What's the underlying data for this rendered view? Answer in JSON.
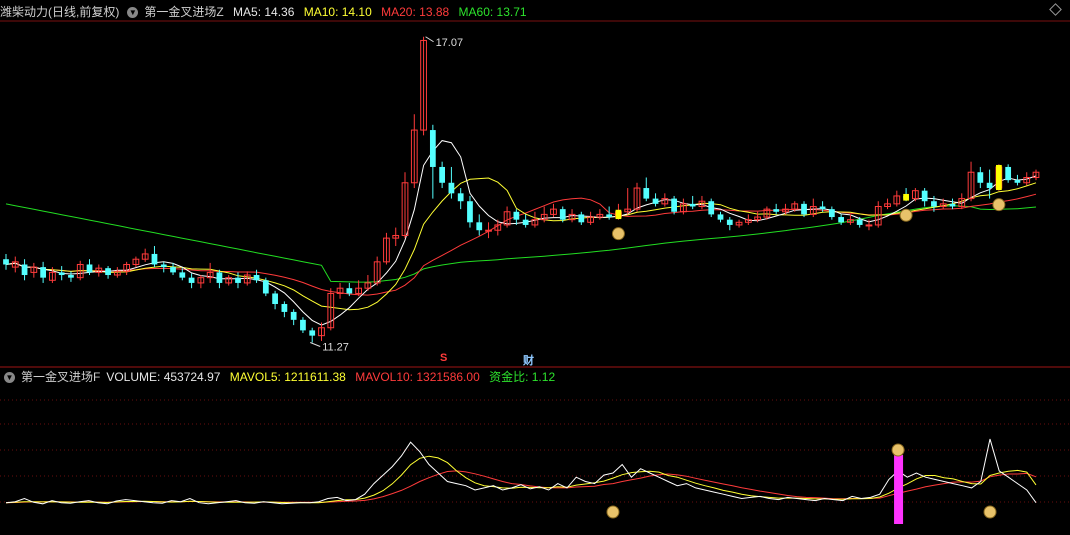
{
  "main_header": {
    "stock": "潍柴动力(日线,前复权)",
    "indicator": "第一金叉进场Z",
    "ma5": "MA5: 14.36",
    "ma10": "MA10: 14.10",
    "ma20": "MA20: 13.88",
    "ma60": "MA60: 13.71"
  },
  "vol_header": {
    "indicator": "第一金叉进场F",
    "volume": "VOLUME: 453724.97",
    "mavol5": "MAVOL5: 1211611.38",
    "mavol10": "MAVOL10: 1321586.00",
    "fund_ratio": "资金比: 1.12"
  },
  "markers": {
    "s": "S",
    "cai": "财"
  },
  "colors": {
    "up": "#ff3b3b",
    "down": "#54ffff",
    "ma5": "#ffffff",
    "ma10": "#ffff33",
    "ma20": "#ff3b3b",
    "ma60": "#22dd22",
    "signal": "#ffff00",
    "vol_spike": "#ff33ff"
  },
  "chart_data": [
    {
      "type": "candlestick",
      "title": "潍柴动力(日线,前复权)",
      "annotations": {
        "high": "17.07",
        "low": "11.27"
      },
      "ylim": [
        10.9,
        17.35
      ],
      "candles": [
        [
          12.85,
          12.75,
          12.95,
          12.65
        ],
        [
          12.7,
          12.8,
          12.9,
          12.6
        ],
        [
          12.75,
          12.55,
          12.85,
          12.45
        ],
        [
          12.6,
          12.7,
          12.78,
          12.5
        ],
        [
          12.7,
          12.5,
          12.8,
          12.4
        ],
        [
          12.45,
          12.6,
          12.7,
          12.4
        ],
        [
          12.6,
          12.55,
          12.72,
          12.45
        ],
        [
          12.55,
          12.5,
          12.62,
          12.42
        ],
        [
          12.5,
          12.75,
          12.82,
          12.45
        ],
        [
          12.75,
          12.6,
          12.85,
          12.55
        ],
        [
          12.6,
          12.68,
          12.75,
          12.52
        ],
        [
          12.68,
          12.55,
          12.72,
          12.48
        ],
        [
          12.55,
          12.62,
          12.7,
          12.5
        ],
        [
          12.62,
          12.75,
          12.8,
          12.55
        ],
        [
          12.75,
          12.85,
          12.9,
          12.7
        ],
        [
          12.85,
          12.95,
          13.05,
          12.8
        ],
        [
          12.95,
          12.75,
          13.1,
          12.7
        ],
        [
          12.75,
          12.7,
          12.8,
          12.6
        ],
        [
          12.7,
          12.6,
          12.78,
          12.55
        ],
        [
          12.6,
          12.5,
          12.68,
          12.45
        ],
        [
          12.5,
          12.4,
          12.58,
          12.3
        ],
        [
          12.4,
          12.5,
          12.55,
          12.3
        ],
        [
          12.5,
          12.6,
          12.78,
          12.4
        ],
        [
          12.6,
          12.4,
          12.65,
          12.3
        ],
        [
          12.4,
          12.5,
          12.55,
          12.35
        ],
        [
          12.5,
          12.4,
          12.6,
          12.3
        ],
        [
          12.4,
          12.55,
          12.62,
          12.35
        ],
        [
          12.55,
          12.45,
          12.65,
          12.4
        ],
        [
          12.45,
          12.2,
          12.5,
          12.15
        ],
        [
          12.2,
          12.0,
          12.25,
          11.9
        ],
        [
          12.0,
          11.85,
          12.05,
          11.75
        ],
        [
          11.85,
          11.7,
          11.9,
          11.6
        ],
        [
          11.7,
          11.5,
          11.75,
          11.45
        ],
        [
          11.5,
          11.4,
          11.55,
          11.27
        ],
        [
          11.4,
          11.55,
          11.65,
          11.3
        ],
        [
          11.55,
          12.2,
          12.3,
          11.5
        ],
        [
          12.2,
          12.3,
          12.4,
          12.1
        ],
        [
          12.3,
          12.2,
          12.4,
          12.15
        ],
        [
          12.2,
          12.3,
          12.45,
          12.15
        ],
        [
          12.3,
          12.4,
          12.55,
          12.25
        ],
        [
          12.4,
          12.8,
          12.9,
          12.35
        ],
        [
          12.8,
          13.25,
          13.35,
          12.75
        ],
        [
          13.25,
          13.3,
          13.45,
          13.1
        ],
        [
          13.3,
          14.3,
          14.5,
          13.25
        ],
        [
          14.3,
          15.3,
          15.6,
          14.2
        ],
        [
          15.3,
          17.0,
          17.07,
          15.2
        ],
        [
          15.3,
          14.6,
          15.4,
          14.0
        ],
        [
          14.6,
          14.3,
          14.7,
          14.2
        ],
        [
          14.3,
          14.1,
          14.6,
          14.0
        ],
        [
          14.1,
          13.95,
          14.2,
          13.8
        ],
        [
          13.95,
          13.55,
          14.05,
          13.45
        ],
        [
          13.55,
          13.4,
          13.7,
          13.3
        ],
        [
          13.4,
          13.4,
          13.55,
          13.25
        ],
        [
          13.4,
          13.5,
          13.6,
          13.3
        ],
        [
          13.5,
          13.75,
          13.85,
          13.45
        ],
        [
          13.75,
          13.6,
          13.8,
          13.5
        ],
        [
          13.6,
          13.5,
          13.7,
          13.45
        ],
        [
          13.5,
          13.6,
          13.75,
          13.45
        ],
        [
          13.6,
          13.7,
          13.85,
          13.55
        ],
        [
          13.7,
          13.8,
          13.9,
          13.65
        ],
        [
          13.8,
          13.6,
          13.85,
          13.55
        ],
        [
          13.6,
          13.7,
          13.8,
          13.55
        ],
        [
          13.7,
          13.55,
          13.75,
          13.5
        ],
        [
          13.55,
          13.65,
          13.75,
          13.5
        ],
        [
          13.65,
          13.7,
          13.8,
          13.6
        ],
        [
          13.7,
          13.65,
          13.85,
          13.6
        ],
        [
          13.65,
          13.75,
          13.9,
          13.6
        ],
        [
          13.75,
          13.8,
          14.2,
          13.7
        ],
        [
          13.8,
          14.2,
          14.3,
          13.75
        ],
        [
          14.2,
          14.0,
          14.4,
          13.95
        ],
        [
          14.0,
          13.9,
          14.1,
          13.85
        ],
        [
          13.9,
          14.0,
          14.1,
          13.85
        ],
        [
          14.0,
          13.75,
          14.05,
          13.7
        ],
        [
          13.75,
          13.9,
          14.0,
          13.7
        ],
        [
          13.9,
          13.85,
          14.05,
          13.8
        ],
        [
          13.85,
          13.95,
          14.05,
          13.8
        ],
        [
          13.95,
          13.7,
          14.0,
          13.65
        ],
        [
          13.7,
          13.6,
          13.75,
          13.55
        ],
        [
          13.6,
          13.5,
          13.65,
          13.4
        ],
        [
          13.5,
          13.55,
          13.6,
          13.45
        ],
        [
          13.55,
          13.6,
          13.7,
          13.5
        ],
        [
          13.6,
          13.65,
          13.75,
          13.55
        ],
        [
          13.65,
          13.8,
          13.85,
          13.6
        ],
        [
          13.8,
          13.75,
          13.9,
          13.7
        ],
        [
          13.75,
          13.8,
          13.9,
          13.7
        ],
        [
          13.8,
          13.9,
          13.95,
          13.75
        ],
        [
          13.9,
          13.7,
          13.95,
          13.65
        ],
        [
          13.7,
          13.85,
          14.0,
          13.65
        ],
        [
          13.85,
          13.8,
          13.95,
          13.75
        ],
        [
          13.8,
          13.65,
          13.85,
          13.6
        ],
        [
          13.65,
          13.55,
          13.7,
          13.5
        ],
        [
          13.55,
          13.6,
          13.7,
          13.5
        ],
        [
          13.6,
          13.5,
          13.65,
          13.45
        ],
        [
          13.5,
          13.5,
          13.6,
          13.4
        ],
        [
          13.5,
          13.85,
          13.95,
          13.45
        ],
        [
          13.85,
          13.9,
          14.0,
          13.8
        ],
        [
          13.9,
          14.05,
          14.15,
          13.85
        ],
        [
          14.05,
          14.0,
          14.2,
          13.95
        ],
        [
          14.0,
          14.15,
          14.2,
          13.95
        ],
        [
          14.15,
          13.95,
          14.2,
          13.85
        ],
        [
          13.95,
          13.85,
          14.05,
          13.75
        ],
        [
          13.85,
          13.9,
          14.0,
          13.8
        ],
        [
          13.9,
          13.85,
          14.0,
          13.8
        ],
        [
          13.85,
          14.0,
          14.1,
          13.8
        ],
        [
          14.0,
          14.5,
          14.7,
          13.95
        ],
        [
          14.5,
          14.3,
          14.6,
          14.2
        ],
        [
          14.3,
          14.2,
          14.55,
          14.0
        ],
        [
          14.2,
          14.6,
          14.65,
          14.15
        ],
        [
          14.6,
          14.35,
          14.65,
          14.3
        ],
        [
          14.35,
          14.3,
          14.45,
          14.25
        ],
        [
          14.3,
          14.4,
          14.5,
          14.25
        ],
        [
          14.4,
          14.5,
          14.55,
          14.35
        ]
      ]
    },
    {
      "type": "line",
      "title": "第一金叉进场F",
      "series_keys": [
        "VOLUME",
        "MAVOL5",
        "MAVOL10"
      ],
      "vol": [
        1.0,
        1.05,
        1.2,
        1.02,
        0.95,
        1.1,
        1.0,
        0.98,
        1.05,
        1.1,
        1.0,
        0.95,
        1.08,
        1.15,
        1.1,
        1.05,
        1.0,
        0.98,
        1.1,
        1.05,
        1.2,
        1.0,
        0.95,
        1.0,
        1.05,
        1.1,
        1.0,
        0.98,
        1.05,
        1.0,
        0.95,
        0.98,
        1.0,
        1.0,
        1.05,
        1.2,
        1.25,
        1.1,
        1.15,
        1.4,
        1.9,
        2.3,
        2.7,
        3.2,
        3.85,
        3.4,
        2.8,
        2.4,
        2.0,
        1.9,
        1.8,
        1.6,
        1.7,
        1.8,
        1.6,
        1.7,
        1.85,
        1.65,
        1.75,
        1.6,
        1.9,
        1.7,
        2.2,
        2.0,
        1.9,
        2.3,
        2.4,
        2.8,
        2.2,
        2.6,
        2.4,
        2.2,
        2.0,
        1.8,
        1.9,
        1.7,
        1.6,
        1.5,
        1.4,
        1.3,
        1.2,
        1.25,
        1.3,
        1.2,
        1.15,
        1.25,
        1.2,
        1.15,
        1.1,
        1.2,
        1.15,
        1.1,
        1.3,
        1.2,
        1.25,
        1.4,
        2.1,
        2.5,
        2.2,
        2.4,
        2.2,
        2.1,
        2.0,
        1.9,
        1.8,
        1.7,
        2.0,
        4.0,
        2.5,
        2.2,
        1.9,
        1.6,
        1.0
      ],
      "mavol5": [
        1.0,
        1.02,
        1.05,
        1.05,
        1.04,
        1.05,
        1.04,
        1.03,
        1.02,
        1.03,
        1.02,
        1.01,
        1.04,
        1.06,
        1.06,
        1.07,
        1.06,
        1.04,
        1.03,
        1.04,
        1.07,
        1.06,
        1.04,
        1.02,
        1.02,
        1.02,
        1.02,
        1.03,
        1.04,
        1.03,
        1.01,
        1.0,
        1.01,
        1.0,
        1.0,
        1.05,
        1.1,
        1.14,
        1.15,
        1.22,
        1.36,
        1.57,
        1.89,
        2.3,
        2.79,
        3.09,
        3.19,
        3.11,
        2.89,
        2.5,
        2.18,
        1.94,
        1.8,
        1.76,
        1.7,
        1.68,
        1.73,
        1.72,
        1.71,
        1.71,
        1.75,
        1.73,
        1.83,
        1.88,
        1.94,
        2.02,
        2.16,
        2.32,
        2.42,
        2.46,
        2.48,
        2.44,
        2.28,
        2.2,
        2.06,
        1.92,
        1.8,
        1.7,
        1.58,
        1.5,
        1.4,
        1.33,
        1.29,
        1.25,
        1.22,
        1.22,
        1.22,
        1.2,
        1.18,
        1.18,
        1.16,
        1.16,
        1.19,
        1.19,
        1.2,
        1.27,
        1.45,
        1.69,
        1.89,
        2.12,
        2.28,
        2.28,
        2.18,
        2.12,
        2.0,
        1.9,
        1.88,
        2.28,
        2.4,
        2.48,
        2.52,
        2.44,
        1.84
      ],
      "mavol10": [
        1.0,
        1.01,
        1.03,
        1.04,
        1.04,
        1.05,
        1.04,
        1.04,
        1.03,
        1.04,
        1.03,
        1.02,
        1.03,
        1.04,
        1.05,
        1.06,
        1.06,
        1.05,
        1.05,
        1.05,
        1.06,
        1.06,
        1.05,
        1.04,
        1.04,
        1.04,
        1.04,
        1.03,
        1.03,
        1.03,
        1.02,
        1.02,
        1.02,
        1.02,
        1.01,
        1.03,
        1.05,
        1.07,
        1.08,
        1.11,
        1.18,
        1.29,
        1.43,
        1.58,
        1.78,
        2.0,
        2.18,
        2.34,
        2.47,
        2.5,
        2.45,
        2.36,
        2.25,
        2.12,
        2.0,
        1.9,
        1.86,
        1.79,
        1.74,
        1.71,
        1.7,
        1.7,
        1.74,
        1.76,
        1.78,
        1.86,
        1.9,
        2.0,
        2.08,
        2.16,
        2.26,
        2.32,
        2.35,
        2.31,
        2.25,
        2.15,
        2.06,
        1.97,
        1.88,
        1.8,
        1.71,
        1.63,
        1.55,
        1.48,
        1.41,
        1.34,
        1.29,
        1.25,
        1.24,
        1.22,
        1.19,
        1.19,
        1.2,
        1.2,
        1.21,
        1.22,
        1.33,
        1.44,
        1.55,
        1.64,
        1.75,
        1.83,
        1.9,
        1.97,
        1.98,
        1.97,
        2.02,
        2.22,
        2.3,
        2.35,
        2.35,
        2.38,
        2.22
      ],
      "spike_value": 14
    }
  ]
}
